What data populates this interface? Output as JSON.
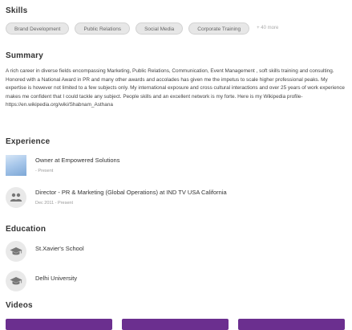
{
  "skills": {
    "title": "Skills",
    "items": [
      "Brand Development",
      "Public Relations",
      "Social Media",
      "Corporate Training"
    ],
    "more": "+ 40 more"
  },
  "summary": {
    "title": "Summary",
    "text": "A rich career in diverse fields encompassing Marketing, Public Relations, Communication, Event Management , soft skills training and consulting. Honored with a National Award in PR and many other awards and accolades has given me the impetus to scale higher professional peaks. My expertise is however not limited to a few subjects only. My international exposure and cross cultural interactions and over 25 years of work experience makes me confident that I could tackle any subject. People skills and an excellent network is my forte. Here is my Wikipedia profile- https://en.wikipedia.org/wiki/Shabnam_Asthana"
  },
  "experience": {
    "title": "Experience",
    "items": [
      {
        "title": "Owner at Empowered Solutions",
        "date": "- Present",
        "icon": "company-logo"
      },
      {
        "title": "Director - PR & Marketing (Global Operations) at IND TV USA California",
        "date": "Dec 2011 - Present",
        "icon": "people-icon"
      }
    ]
  },
  "education": {
    "title": "Education",
    "items": [
      {
        "title": "St.Xavier's School",
        "icon": "graduation-cap-icon"
      },
      {
        "title": "Delhi University",
        "icon": "graduation-cap-icon"
      }
    ]
  },
  "videos": {
    "title": "Videos",
    "count": 3
  },
  "colors": {
    "video_accent": "#6b2f8f",
    "pill_bg": "#e7e7e7",
    "icon_bg": "#e9e9e9"
  }
}
